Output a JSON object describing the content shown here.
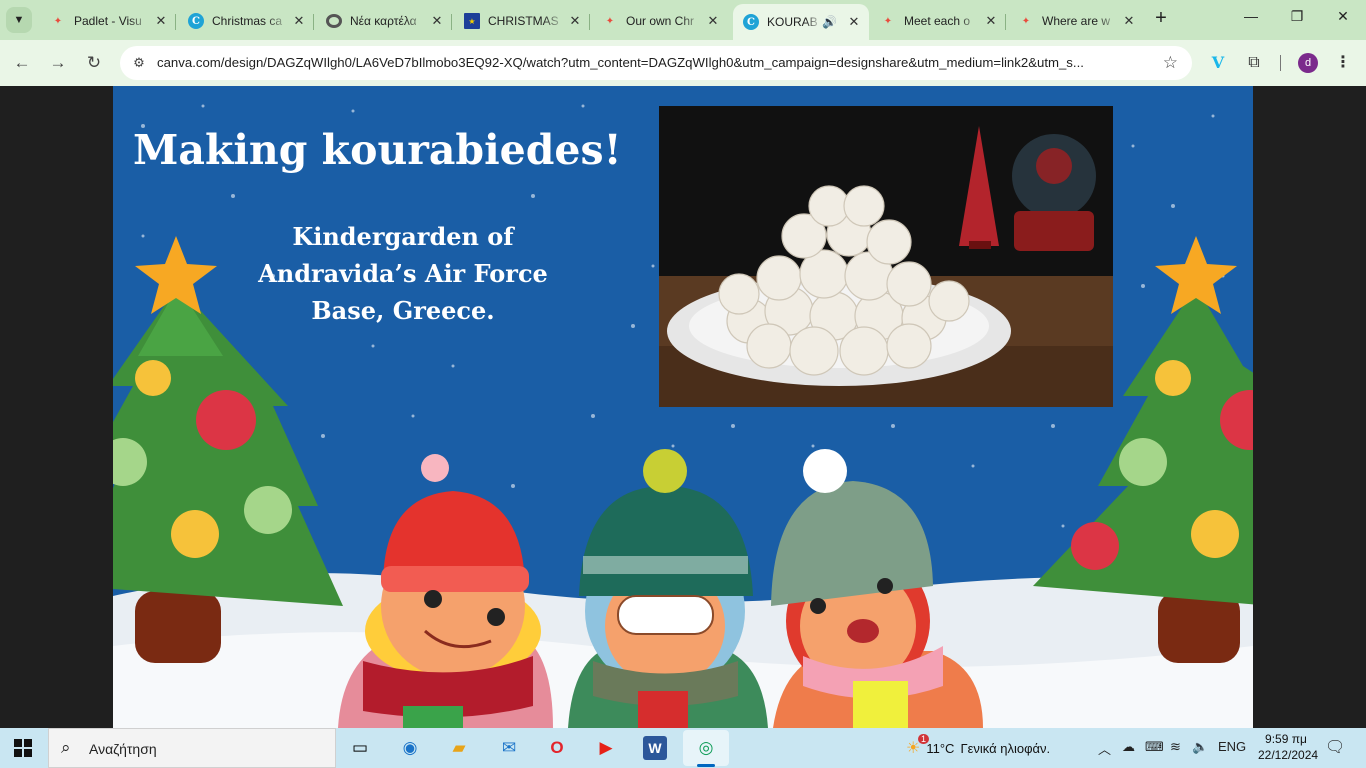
{
  "browser": {
    "tabs": [
      {
        "title": "Padlet - Visu",
        "icon": "padlet-icon",
        "active": false
      },
      {
        "title": "Christmas ca",
        "icon": "canva-icon",
        "active": false
      },
      {
        "title": "Νέα καρτέλα",
        "icon": "chrome-icon",
        "active": false
      },
      {
        "title": "CHRISTMAS",
        "icon": "eu-flag-icon",
        "active": false
      },
      {
        "title": "Our own Chr",
        "icon": "padlet-icon",
        "active": false
      },
      {
        "title": "KOURAB",
        "icon": "canva-icon",
        "active": true
      },
      {
        "title": "Meet each o",
        "icon": "padlet-icon",
        "active": false
      },
      {
        "title": "Where are w",
        "icon": "padlet-icon",
        "active": false
      }
    ],
    "url": "canva.com/design/DAGZqWIlgh0/LA6VeD7bIlmobo3EQ92-XQ/watch?utm_content=DAGZqWIlgh0&utm_campaign=designshare&utm_medium=link2&utm_s...",
    "profile_initial": "d"
  },
  "slide": {
    "title": "Making kourabiedes!",
    "subtitle_lines": [
      "Kindergarden of",
      "Andravida’s Air Force",
      "Base, Greece."
    ]
  },
  "taskbar": {
    "search_placeholder": "Αναζήτηση",
    "weather_temp": "11°C",
    "weather_text": "Γενικά ηλιοφάν.",
    "weather_badge": "1",
    "language": "ENG",
    "time": "9:59 πμ",
    "date": "22/12/2024"
  },
  "colors": {
    "tab_strip": "#c9e6c4",
    "toolbar": "#eaf6e7",
    "slide_bg": "#1a5ea6",
    "taskbar": "#c9e6f2"
  }
}
